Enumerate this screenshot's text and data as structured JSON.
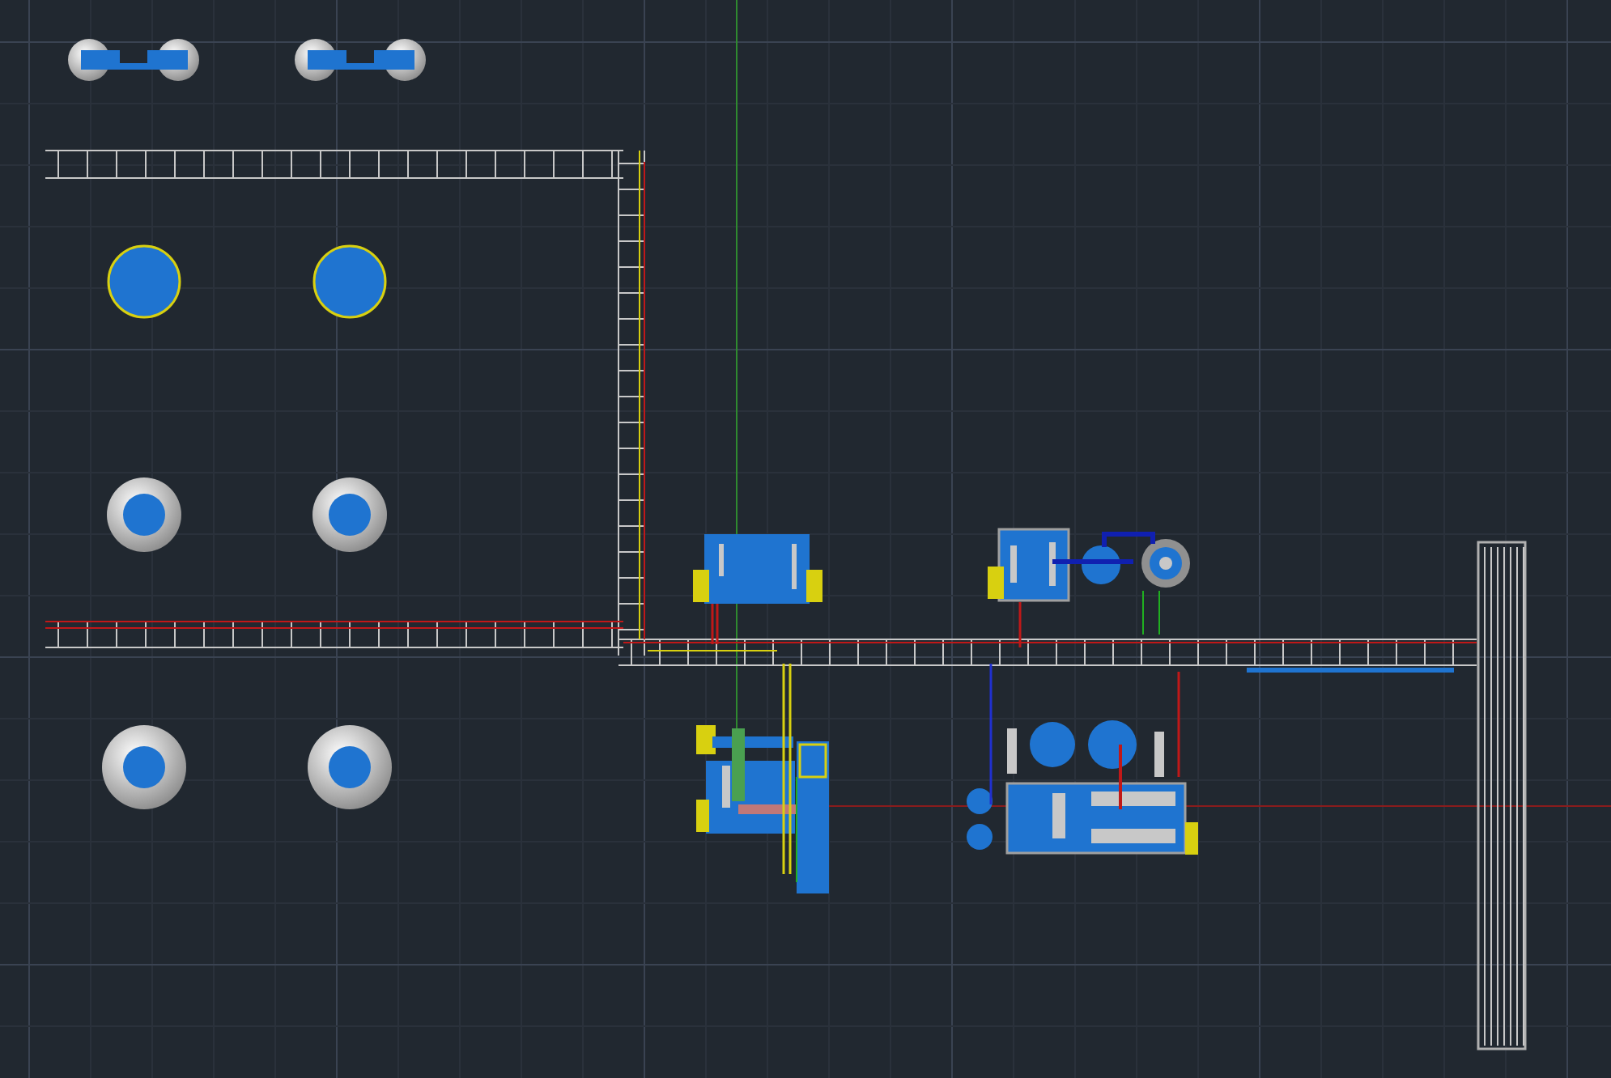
{
  "viewport": {
    "kind": "cad-model-space",
    "grid": true
  }
}
